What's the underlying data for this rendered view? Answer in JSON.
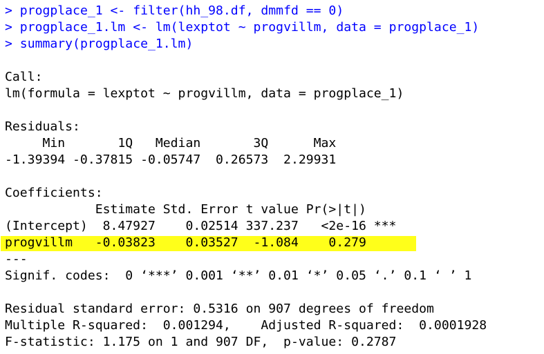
{
  "console": {
    "commands": [
      {
        "prompt": "> ",
        "text": "progplace_1 <- filter(hh_98.df, dmmfd == 0)"
      },
      {
        "prompt": "> ",
        "text": "progplace_1.lm <- lm(lexptot ~ progvillm, data = progplace_1)"
      },
      {
        "prompt": "> ",
        "text": "summary(progplace_1.lm)"
      }
    ],
    "call_header": "Call:",
    "call_formula": "lm(formula = lexptot ~ progvillm, data = progplace_1)",
    "residuals_header": "Residuals:",
    "residuals_labels": "     Min       1Q   Median       3Q      Max ",
    "residuals_values": "-1.39394 -0.37815 -0.05747  0.26573  2.29931 ",
    "coefficients_header": "Coefficients:",
    "coef_columns": "            Estimate Std. Error t value Pr(>|t|)    ",
    "coef_intercept": "(Intercept)  8.47927    0.02514 337.237   <2e-16 ***",
    "coef_progvillm": "progvillm   -0.03823    0.03527  -1.084    0.279    ",
    "separator": "---",
    "signif_codes": "Signif. codes:  0 ‘***’ 0.001 ‘**’ 0.01 ‘*’ 0.05 ‘.’ 0.1 ‘ ’ 1",
    "residual_se": "Residual standard error: 0.5316 on 907 degrees of freedom",
    "r_squared": "Multiple R-squared:  0.001294,\tAdjusted R-squared:  0.0001928 ",
    "f_statistic": "F-statistic: 1.175 on 1 and 907 DF,  p-value: 0.2787"
  },
  "colors": {
    "command": "#0000ff",
    "output": "#000000",
    "highlight": "#ffff1a"
  }
}
